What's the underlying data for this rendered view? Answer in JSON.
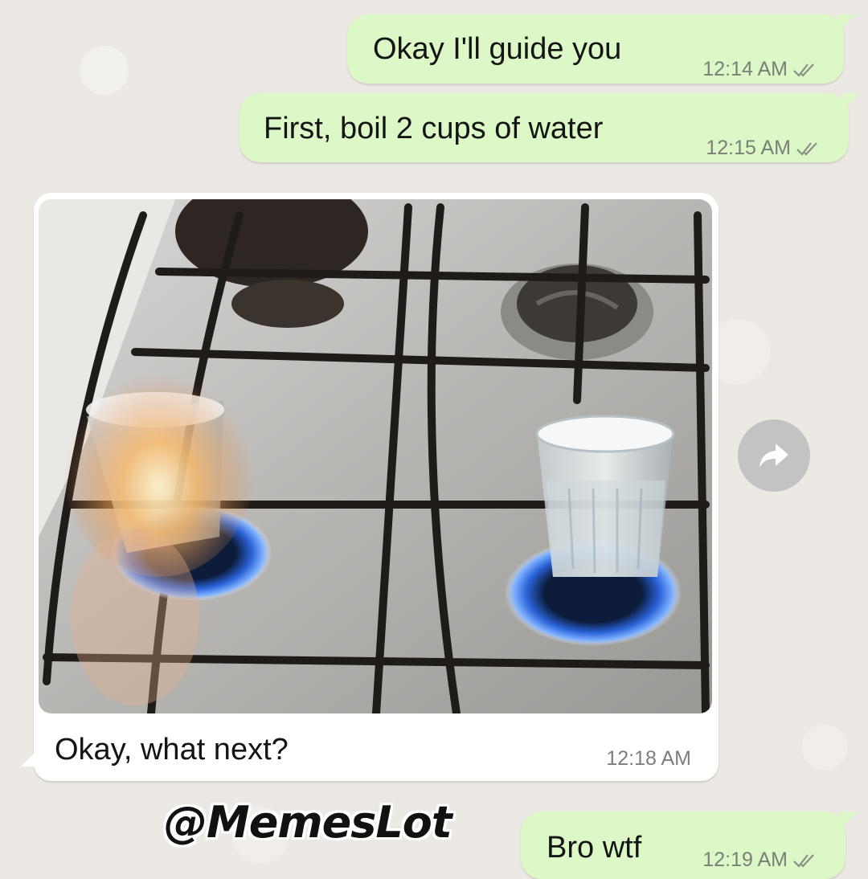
{
  "chat": {
    "messages": [
      {
        "direction": "outgoing",
        "text": "Okay I'll guide you",
        "time": "12:14 AM",
        "status": "read"
      },
      {
        "direction": "outgoing",
        "text": "First, boil 2 cups of water",
        "time": "12:15 AM",
        "status": "read"
      },
      {
        "direction": "incoming",
        "type": "image",
        "text": "Okay, what next?",
        "time": "12:18 AM"
      },
      {
        "direction": "outgoing",
        "text": "Bro wtf",
        "time": "12:19 AM",
        "status": "read"
      }
    ]
  },
  "actions": {
    "forward_icon": "forward-arrow-icon"
  },
  "watermark": {
    "text": "@MemesLot"
  },
  "colors": {
    "outgoing_bubble": "#dcf8c6",
    "incoming_bubble": "#ffffff",
    "background": "#ece8e3",
    "timestamp": "#7a7f78",
    "flame_blue": "#3b7bff"
  }
}
